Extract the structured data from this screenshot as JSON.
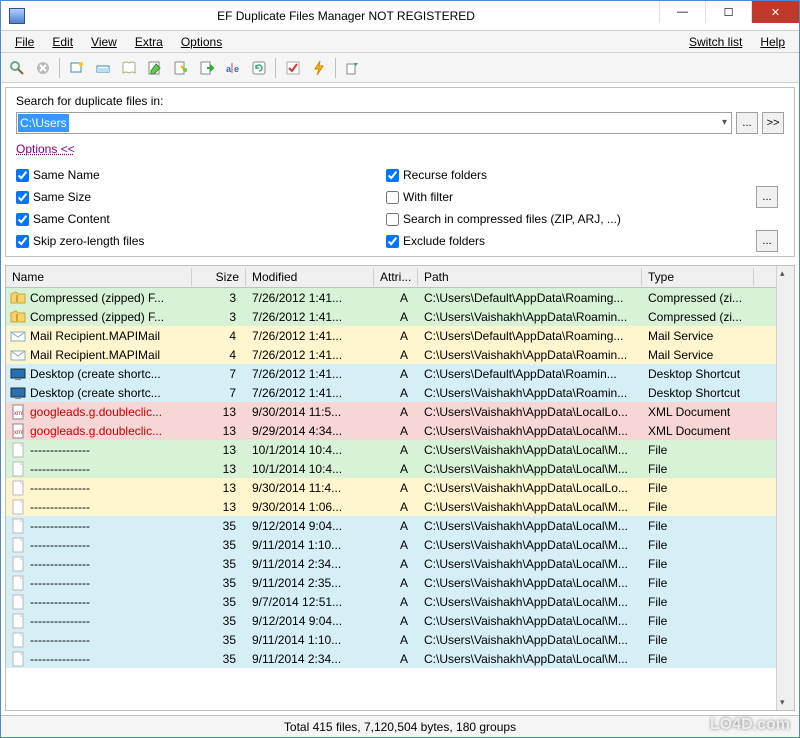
{
  "title": "EF Duplicate Files Manager NOT REGISTERED",
  "menu": {
    "file": "File",
    "edit": "Edit",
    "view": "View",
    "extra": "Extra",
    "options": "Options",
    "switch": "Switch list",
    "help": "Help"
  },
  "search": {
    "label": "Search for duplicate files in:",
    "path": "C:\\Users",
    "browse": "...",
    "next": ">>",
    "optionsLink": "Options  <<"
  },
  "opts": {
    "sameName": "Same Name",
    "sameSize": "Same Size",
    "sameContent": "Same Content",
    "skipZero": "Skip zero-length files",
    "recurse": "Recurse folders",
    "withFilter": "With filter",
    "compressed": "Search in compressed files (ZIP, ARJ, ...)",
    "exclude": "Exclude folders"
  },
  "columns": {
    "name": "Name",
    "size": "Size",
    "modified": "Modified",
    "attr": "Attri...",
    "path": "Path",
    "type": "Type"
  },
  "rows": [
    {
      "ico": "zip",
      "name": "Compressed (zipped) F...",
      "size": "3",
      "mod": "7/26/2012  1:41...",
      "at": "A",
      "path": "C:\\Users\\Default\\AppData\\Roaming...",
      "type": "Compressed (zi...",
      "bg": "#d7f2d7"
    },
    {
      "ico": "zip",
      "name": "Compressed (zipped) F...",
      "size": "3",
      "mod": "7/26/2012  1:41...",
      "at": "A",
      "path": "C:\\Users\\Vaishakh\\AppData\\Roamin...",
      "type": "Compressed (zi...",
      "bg": "#d7f2d7"
    },
    {
      "ico": "mail",
      "name": "Mail Recipient.MAPIMail",
      "size": "4",
      "mod": "7/26/2012  1:41...",
      "at": "A",
      "path": "C:\\Users\\Default\\AppData\\Roaming...",
      "type": "Mail Service",
      "bg": "#fff6cf"
    },
    {
      "ico": "mail",
      "name": "Mail Recipient.MAPIMail",
      "size": "4",
      "mod": "7/26/2012  1:41...",
      "at": "A",
      "path": "C:\\Users\\Vaishakh\\AppData\\Roamin...",
      "type": "Mail Service",
      "bg": "#fff6cf"
    },
    {
      "ico": "desk",
      "name": "Desktop (create shortc...",
      "size": "7",
      "mod": "7/26/2012  1:41...",
      "at": "A",
      "path": "C:\\Users\\Default\\AppData\\Roamin...",
      "type": "Desktop Shortcut",
      "bg": "#d6eef6"
    },
    {
      "ico": "desk",
      "name": "Desktop (create shortc...",
      "size": "7",
      "mod": "7/26/2012  1:41...",
      "at": "A",
      "path": "C:\\Users\\Vaishakh\\AppData\\Roamin...",
      "type": "Desktop Shortcut",
      "bg": "#d6eef6"
    },
    {
      "ico": "xml",
      "name": "googleads.g.doubleclic...",
      "size": "13",
      "mod": "9/30/2014  11:5...",
      "at": "A",
      "path": "C:\\Users\\Vaishakh\\AppData\\LocalLo...",
      "type": "XML Document",
      "bg": "#f7d6d6",
      "red": true
    },
    {
      "ico": "xml",
      "name": "googleads.g.doubleclic...",
      "size": "13",
      "mod": "9/29/2014  4:34...",
      "at": "A",
      "path": "C:\\Users\\Vaishakh\\AppData\\Local\\M...",
      "type": "XML Document",
      "bg": "#f7d6d6",
      "red": true
    },
    {
      "ico": "file",
      "name": "---------------",
      "size": "13",
      "mod": "10/1/2014  10:4...",
      "at": "A",
      "path": "C:\\Users\\Vaishakh\\AppData\\Local\\M...",
      "type": "File",
      "bg": "#d7f2d7"
    },
    {
      "ico": "file",
      "name": "---------------",
      "size": "13",
      "mod": "10/1/2014  10:4...",
      "at": "A",
      "path": "C:\\Users\\Vaishakh\\AppData\\Local\\M...",
      "type": "File",
      "bg": "#d7f2d7"
    },
    {
      "ico": "file",
      "name": "---------------",
      "size": "13",
      "mod": "9/30/2014  11:4...",
      "at": "A",
      "path": "C:\\Users\\Vaishakh\\AppData\\LocalLo...",
      "type": "File",
      "bg": "#fff6cf"
    },
    {
      "ico": "file",
      "name": "---------------",
      "size": "13",
      "mod": "9/30/2014  1:06...",
      "at": "A",
      "path": "C:\\Users\\Vaishakh\\AppData\\Local\\M...",
      "type": "File",
      "bg": "#fff6cf"
    },
    {
      "ico": "file",
      "name": "---------------",
      "size": "35",
      "mod": "9/12/2014  9:04...",
      "at": "A",
      "path": "C:\\Users\\Vaishakh\\AppData\\Local\\M...",
      "type": "File",
      "bg": "#d6eef6"
    },
    {
      "ico": "file",
      "name": "---------------",
      "size": "35",
      "mod": "9/11/2014  1:10...",
      "at": "A",
      "path": "C:\\Users\\Vaishakh\\AppData\\Local\\M...",
      "type": "File",
      "bg": "#d6eef6"
    },
    {
      "ico": "file",
      "name": "---------------",
      "size": "35",
      "mod": "9/11/2014  2:34...",
      "at": "A",
      "path": "C:\\Users\\Vaishakh\\AppData\\Local\\M...",
      "type": "File",
      "bg": "#d6eef6"
    },
    {
      "ico": "file",
      "name": "---------------",
      "size": "35",
      "mod": "9/11/2014  2:35...",
      "at": "A",
      "path": "C:\\Users\\Vaishakh\\AppData\\Local\\M...",
      "type": "File",
      "bg": "#d6eef6"
    },
    {
      "ico": "file",
      "name": "---------------",
      "size": "35",
      "mod": "9/7/2014  12:51...",
      "at": "A",
      "path": "C:\\Users\\Vaishakh\\AppData\\Local\\M...",
      "type": "File",
      "bg": "#d6eef6"
    },
    {
      "ico": "file",
      "name": "---------------",
      "size": "35",
      "mod": "9/12/2014  9:04...",
      "at": "A",
      "path": "C:\\Users\\Vaishakh\\AppData\\Local\\M...",
      "type": "File",
      "bg": "#d6eef6"
    },
    {
      "ico": "file",
      "name": "---------------",
      "size": "35",
      "mod": "9/11/2014  1:10...",
      "at": "A",
      "path": "C:\\Users\\Vaishakh\\AppData\\Local\\M...",
      "type": "File",
      "bg": "#d6eef6"
    },
    {
      "ico": "file",
      "name": "---------------",
      "size": "35",
      "mod": "9/11/2014  2:34...",
      "at": "A",
      "path": "C:\\Users\\Vaishakh\\AppData\\Local\\M...",
      "type": "File",
      "bg": "#d6eef6"
    }
  ],
  "status": "Total 415 files, 7,120,504 bytes, 180 groups",
  "watermark": "LO4D.com"
}
